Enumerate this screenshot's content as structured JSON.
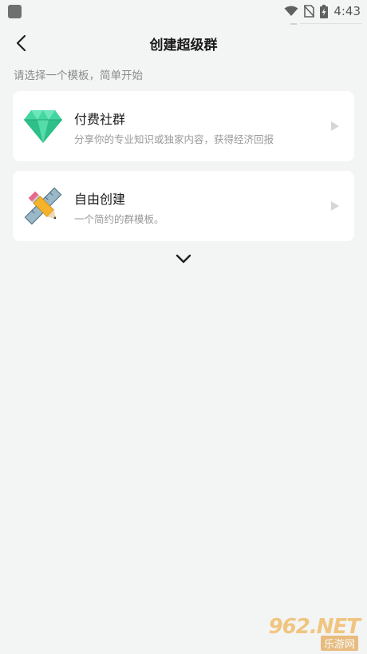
{
  "status_bar": {
    "time": "4:43",
    "icons": [
      "app-notification-icon",
      "wifi-icon",
      "no-sim-icon",
      "battery-charging-icon"
    ]
  },
  "header": {
    "back_icon": "chevron-left-icon",
    "title": "创建超级群"
  },
  "subtitle": "请选择一个模板，简单开始",
  "templates": [
    {
      "icon": "diamond-icon",
      "title": "付费社群",
      "description": "分享你的专业知识或独家内容，获得经济回报",
      "arrow_icon": "play-arrow-icon"
    },
    {
      "icon": "pencil-ruler-icon",
      "title": "自由创建",
      "description": "一个简约的群模板。",
      "arrow_icon": "play-arrow-icon"
    }
  ],
  "expand_icon": "chevron-down-icon",
  "watermark": {
    "top": "962.NET",
    "bottom": "乐游网"
  },
  "colors": {
    "background": "#f3f4f4",
    "card": "#ffffff",
    "diamond": "#3ccf9a",
    "pencil": "#f5b22a"
  }
}
